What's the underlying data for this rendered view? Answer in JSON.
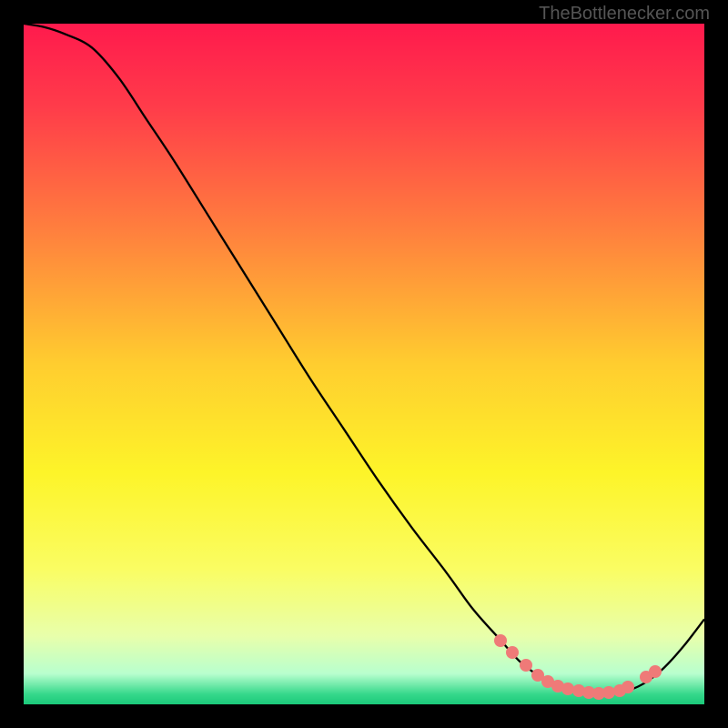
{
  "watermark": "TheBottlenecker.com",
  "chart_data": {
    "type": "line",
    "title": "",
    "xlabel": "",
    "ylabel": "",
    "xlim": [
      0,
      100
    ],
    "ylim": [
      0,
      100
    ],
    "background_gradient": {
      "direction": "vertical",
      "stops": [
        {
          "pos": 0.0,
          "color": "#ff1a4d"
        },
        {
          "pos": 0.12,
          "color": "#ff3b4a"
        },
        {
          "pos": 0.3,
          "color": "#ff7e3e"
        },
        {
          "pos": 0.5,
          "color": "#ffcd2f"
        },
        {
          "pos": 0.66,
          "color": "#fdf429"
        },
        {
          "pos": 0.8,
          "color": "#fafd62"
        },
        {
          "pos": 0.9,
          "color": "#e8ffab"
        },
        {
          "pos": 0.955,
          "color": "#b8ffce"
        },
        {
          "pos": 0.985,
          "color": "#36d88b"
        },
        {
          "pos": 1.0,
          "color": "#1bc97a"
        }
      ]
    },
    "series": [
      {
        "name": "bottleneck-curve",
        "x": [
          0,
          3,
          6,
          10,
          14,
          18,
          22,
          27,
          32,
          37,
          42,
          47,
          52,
          57,
          62,
          66,
          70,
          73,
          76,
          79,
          82,
          85,
          88,
          91,
          94,
          97,
          100
        ],
        "y": [
          100,
          99.5,
          98.5,
          96.5,
          92,
          86,
          80,
          72,
          64,
          56,
          48,
          40.5,
          33,
          26,
          19.5,
          14,
          9.5,
          6.2,
          4.0,
          2.5,
          1.8,
          1.5,
          1.8,
          3.0,
          5.3,
          8.6,
          12.5
        ]
      }
    ],
    "highlight_points": {
      "name": "optimal-zone-dots",
      "color": "#ef7a78",
      "points": [
        {
          "x": 70.0,
          "y": 9.3
        },
        {
          "x": 71.8,
          "y": 7.6
        },
        {
          "x": 73.8,
          "y": 5.8
        },
        {
          "x": 75.5,
          "y": 4.3
        },
        {
          "x": 77.0,
          "y": 3.4
        },
        {
          "x": 78.5,
          "y": 2.7
        },
        {
          "x": 80.0,
          "y": 2.3
        },
        {
          "x": 81.5,
          "y": 2.0
        },
        {
          "x": 83.0,
          "y": 1.7
        },
        {
          "x": 84.5,
          "y": 1.6
        },
        {
          "x": 86.0,
          "y": 1.7
        },
        {
          "x": 87.5,
          "y": 2.0
        },
        {
          "x": 88.8,
          "y": 2.5
        },
        {
          "x": 91.5,
          "y": 4.0
        },
        {
          "x": 92.8,
          "y": 4.8
        }
      ]
    }
  }
}
